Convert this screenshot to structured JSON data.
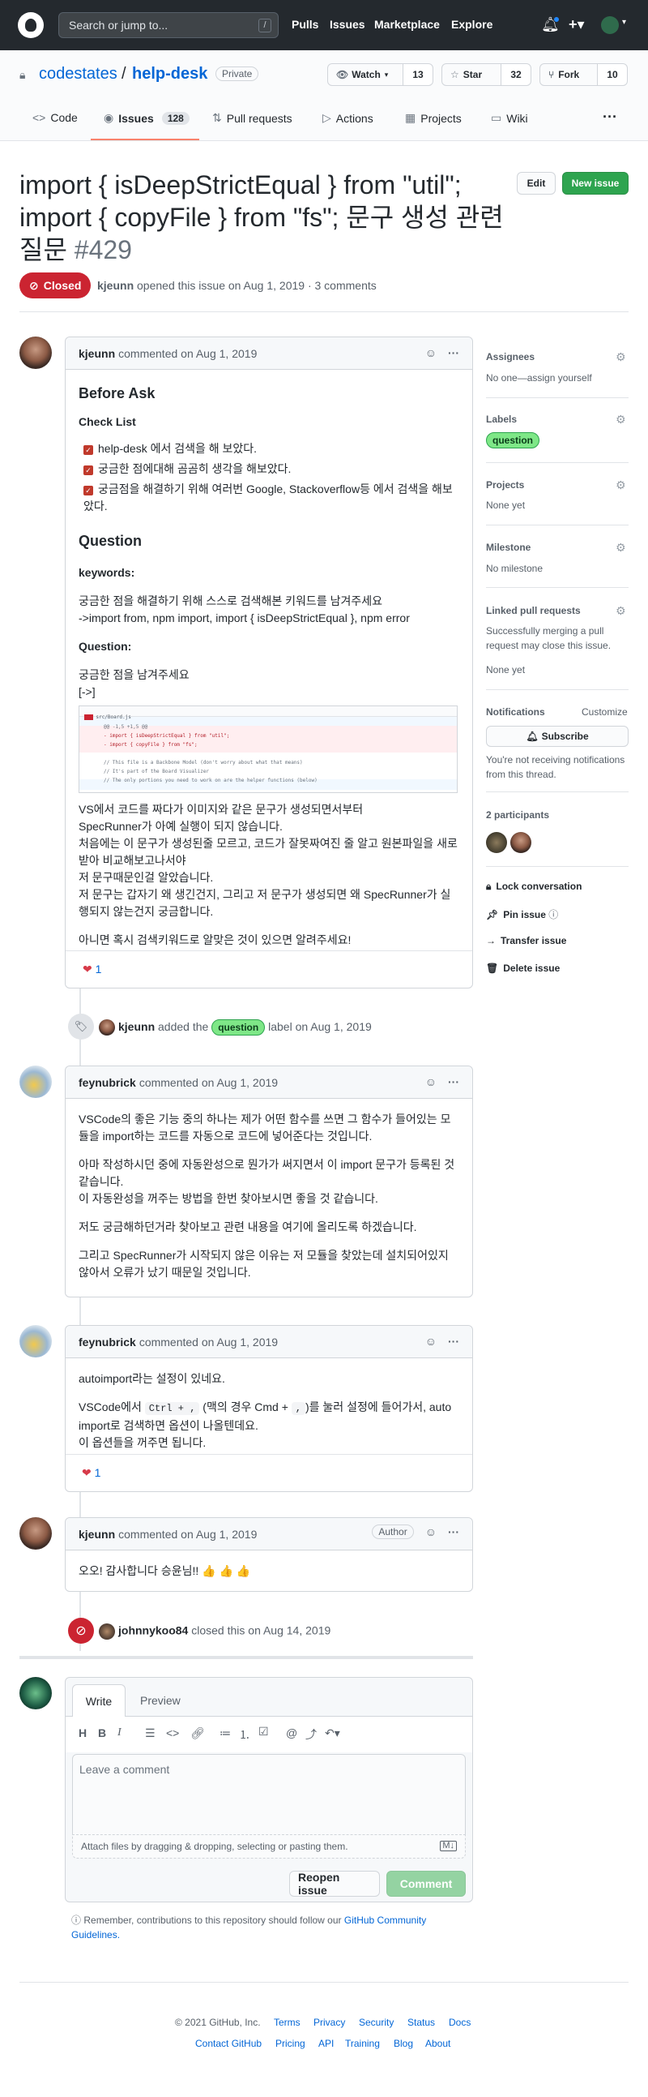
{
  "global_nav": {
    "search_placeholder": "Search or jump to...",
    "slash_hint": "/",
    "links": [
      "Pulls",
      "Issues",
      "Marketplace",
      "Explore"
    ]
  },
  "repo": {
    "owner": "codestates",
    "separator": "/",
    "name": "help-desk",
    "visibility": "Private",
    "watch_label": "Watch",
    "watch_count": "13",
    "star_label": "Star",
    "star_count": "32",
    "fork_label": "Fork",
    "fork_count": "10"
  },
  "tabs": [
    {
      "label": "Code",
      "icon": "code-icon"
    },
    {
      "label": "Issues",
      "icon": "issue-icon",
      "count": "128"
    },
    {
      "label": "Pull requests",
      "icon": "pull-request-icon"
    },
    {
      "label": "Actions",
      "icon": "play-icon"
    },
    {
      "label": "Projects",
      "icon": "project-icon"
    },
    {
      "label": "Wiki",
      "icon": "book-icon"
    }
  ],
  "issue": {
    "title_line1": "import { isDeepStrictEqual } from \"util\";",
    "title_line2": "import { copyFile } from \"fs\"; 문구 생성 관련",
    "title_line3": "질문",
    "number": "#429",
    "edit_label": "Edit",
    "new_issue_label": "New issue",
    "state": "Closed",
    "author": "kjeunn",
    "opened_text": "opened this issue on Aug 1, 2019 · 3 comments"
  },
  "comments": [
    {
      "author": "kjeunn",
      "meta": "commented on Aug 1, 2019",
      "h_before": "Before Ask",
      "checklist_title": "Check List",
      "checklist": [
        "help-desk 에서 검색을 해 보았다.",
        "궁금한 점에대해 곰곰히 생각을 해보았다.",
        "궁금점을 해결하기 위해 여러번 Google, Stackoverflow등 에서 검색을 해보았다."
      ],
      "h_question": "Question",
      "keywords_label": "keywords:",
      "keywords_p1": "궁금한 점을 해결하기 위해 스스로 검색해본 키워드를 남겨주세요",
      "keywords_p2": "->import from, npm import, import { isDeepStrictEqual }, npm error",
      "question_label": "Question:",
      "question_p1": "궁금한 점을 남겨주세요",
      "question_p2": "[->]",
      "diff_file": "src/Board.js",
      "diff_hunk": "@@ -1,5 +1,5 @@",
      "diff_lines": [
        "- import { isDeepStrictEqual } from \"util\";",
        "- import { copyFile } from \"fs\";",
        "  // This file is a Backbone Model (don't worry about what that means)",
        "  // It's part of the Board Visualizer",
        "  // The only portions you need to work on are the helper functions (below)"
      ],
      "body": [
        "VS에서 코드를 짜다가 이미지와 같은 문구가 생성되면서부터",
        "SpecRunner가 아예 실행이 되지 않습니다.",
        "처음에는 이 문구가 생성된줄 모르고, 코드가 잘못짜여진 줄 알고 원본파일을 새로 받아 비교해보고나서야",
        "저 문구때문인걸 알았습니다.",
        "저 문구는 갑자기 왜 생긴건지, 그리고 저 문구가 생성되면 왜 SpecRunner가 실행되지 않는건지 궁금합니다."
      ],
      "closing": "아니면 혹시 검색키워드로 알맞은 것이 있으면 알려주세요!",
      "reaction": "1"
    },
    {
      "author": "feynubrick",
      "meta": "commented on Aug 1, 2019",
      "paragraphs": [
        "VSCode의 좋은 기능 중의 하나는 제가 어떤 함수를 쓰면 그 함수가 들어있는 모듈을 import하는 코드를 자동으로 코드에 넣어준다는 것입니다.",
        "아마 작성하시던 중에 자동완성으로 뭔가가 써지면서 이 import 문구가 등록된 것 같습니다.",
        "이 자동완성을 꺼주는 방법을 한번 찾아보시면 좋을 것 같습니다.",
        "저도 궁금해하던거라 찾아보고 관련 내용을 여기에 올리도록 하겠습니다.",
        "그리고 SpecRunner가 시작되지 않은 이유는 저 모듈을 찾았는데 설치되어있지 않아서 오류가 났기 때문일 것입니다."
      ]
    },
    {
      "author": "feynubrick",
      "meta": "commented on Aug 1, 2019",
      "p1": "autoimport라는 설정이 있네요.",
      "p2_a": "VSCode에서",
      "p2_code1": "Ctrl + ,",
      "p2_b": "(맥의 경우 Cmd +",
      "p2_code2": ",",
      "p2_c": ")를 눌러 설정에 들어가서, auto import로 검색하면 옵션이 나올텐데요.",
      "p3": "이 옵션들을 꺼주면 됩니다.",
      "reaction": "1"
    },
    {
      "author": "kjeunn",
      "meta": "commented on Aug 1, 2019",
      "badge": "Author",
      "body": "오오! 감사합니다 승윤님!! 👍 👍 👍"
    }
  ],
  "events": {
    "label_actor": "kjeunn",
    "label_text1": "added the",
    "label_name": "question",
    "label_text2": "label on Aug 1, 2019",
    "close_actor": "johnnykoo84",
    "close_text": "closed this on Aug 14, 2019"
  },
  "sidebar": {
    "assignees_title": "Assignees",
    "assignees_value": "No one—assign yourself",
    "labels_title": "Labels",
    "label": "question",
    "projects_title": "Projects",
    "projects_value": "None yet",
    "milestone_title": "Milestone",
    "milestone_value": "No milestone",
    "linked_title": "Linked pull requests",
    "linked_desc": "Successfully merging a pull request may close this issue.",
    "linked_value": "None yet",
    "notifications_title": "Notifications",
    "customize": "Customize",
    "subscribe": "Subscribe",
    "notif_desc": "You're not receiving notifications from this thread.",
    "participants": "2 participants",
    "lock": "Lock conversation",
    "pin": "Pin issue",
    "transfer": "Transfer issue",
    "delete": "Delete issue"
  },
  "composer": {
    "write_tab": "Write",
    "preview_tab": "Preview",
    "placeholder": "Leave a comment",
    "attach_text": "Attach files by dragging & dropping, selecting or pasting them.",
    "reopen": "Reopen issue",
    "comment": "Comment",
    "remember": "Remember, contributions to this repository should follow our",
    "guidelines": "GitHub Community Guidelines."
  },
  "footer": {
    "copyright": "© 2021 GitHub, Inc.",
    "row1": [
      "Terms",
      "Privacy",
      "Security",
      "Status",
      "Docs"
    ],
    "row2": [
      "Contact GitHub",
      "Pricing",
      "API",
      "Training",
      "Blog",
      "About"
    ]
  },
  "colors": {
    "header_bg": "#24292e",
    "closed_red": "#cb2431",
    "new_issue_green": "#2ea44f",
    "link_blue": "#0366d6",
    "label_question": "#7ee787"
  }
}
